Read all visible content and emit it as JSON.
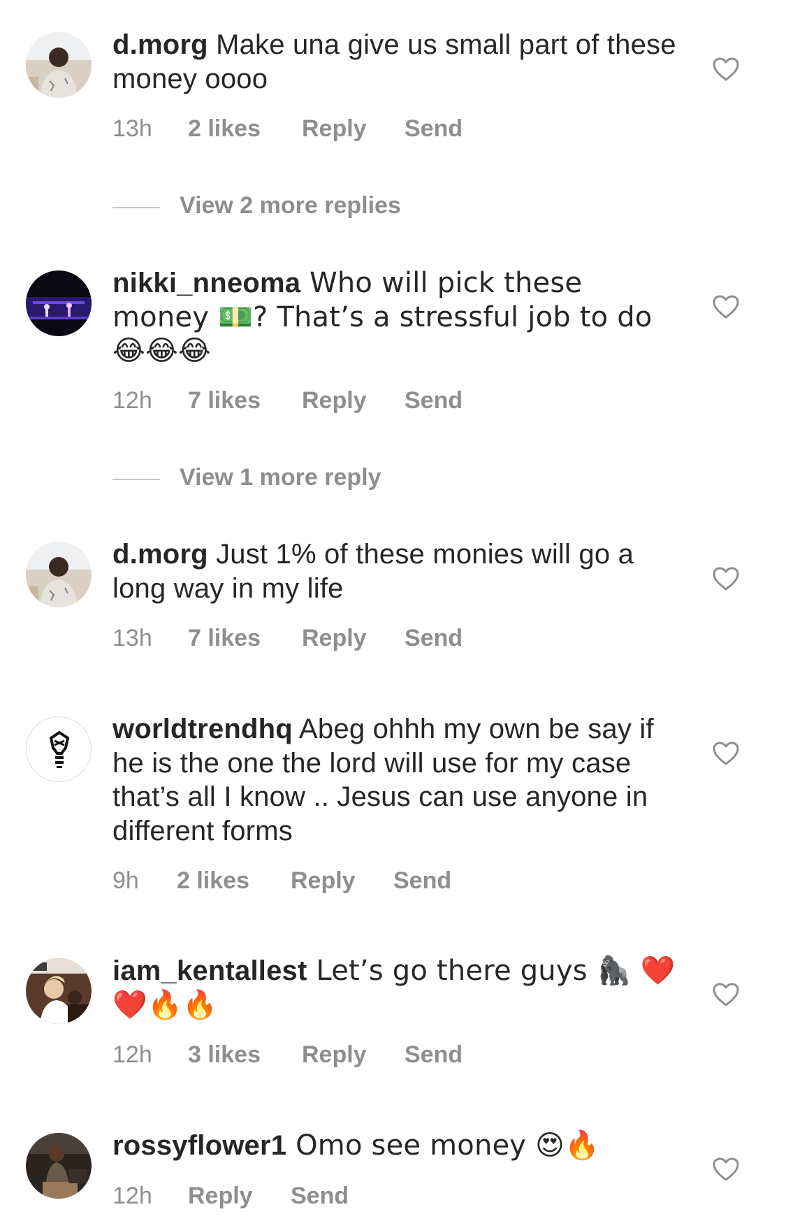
{
  "comments": [
    {
      "username": "d.morg",
      "text": " Make una give us small part of these money oooo",
      "time": "13h",
      "likes": "2 likes",
      "reply": "Reply",
      "send": "Send",
      "view_more": "View 2 more replies"
    },
    {
      "username": "nikki_nneoma",
      "text": " Who will pick these money 💵? That’s a stressful job to do 😂😂😂",
      "time": "12h",
      "likes": "7 likes",
      "reply": "Reply",
      "send": "Send",
      "view_more": "View 1 more reply"
    },
    {
      "username": "d.morg",
      "text": " Just 1% of these monies will go a long way in my life",
      "time": "13h",
      "likes": "7 likes",
      "reply": "Reply",
      "send": "Send"
    },
    {
      "username": "worldtrendhq",
      "text": " Abeg ohhh my own be say if he is the one the lord will use for my case that’s all I know .. Jesus can use anyone in different forms",
      "time": "9h",
      "likes": "2 likes",
      "reply": "Reply",
      "send": "Send"
    },
    {
      "username": "iam_kentallest",
      "text": " Let’s go there guys 🦍 ❤️❤️🔥🔥",
      "time": "12h",
      "likes": "3 likes",
      "reply": "Reply",
      "send": "Send"
    },
    {
      "username": "rossyflower1",
      "text": " Omo see money 😍🔥",
      "time": "12h",
      "reply": "Reply",
      "send": "Send"
    }
  ],
  "colors": {
    "text": "#262626",
    "meta": "#8e8e8e",
    "divider": "#c7c7c7"
  },
  "icons": {
    "like": "heart-outline-icon"
  }
}
